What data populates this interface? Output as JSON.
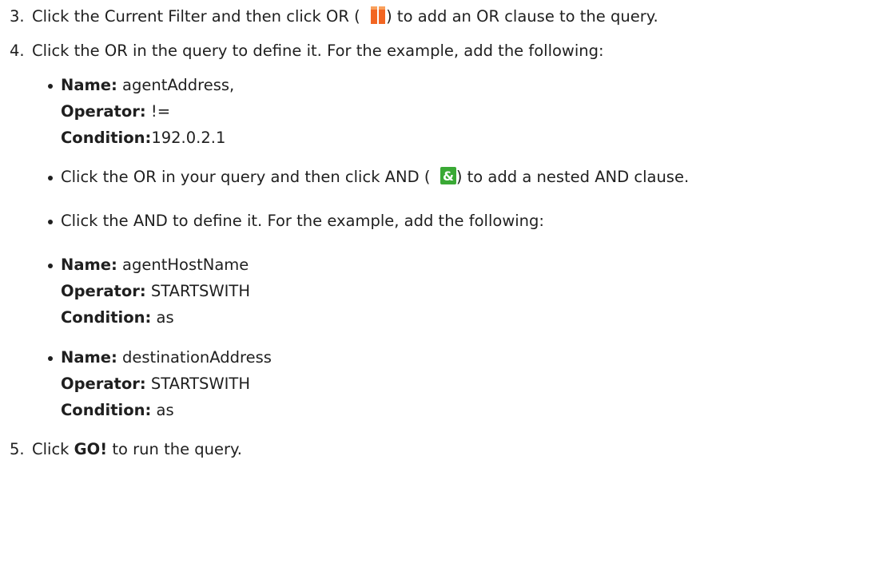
{
  "steps": {
    "s3": {
      "num": "3.",
      "pre": "Click the Current Filter and then click OR (",
      "icon": "or-icon",
      "post": ") to add an OR clause to the query."
    },
    "s4": {
      "num": "4.",
      "text": "Click the OR in the query to define it. For the example, add the following:"
    },
    "b1": {
      "name_label": "Name:",
      "name_value": " agentAddress,",
      "operator_label": "Operator:",
      "operator_value": " !=",
      "condition_label": "Condition:",
      "condition_value": "192.0.2.1"
    },
    "b2": {
      "pre": "Click the OR in your query and then click AND (",
      "icon": "and-icon",
      "post": ") to add a nested AND clause."
    },
    "b3": {
      "text": "Click the AND to define it. For the example, add the following:"
    },
    "b4": {
      "name_label": "Name:",
      "name_value": " agentHostName",
      "operator_label": "Operator:",
      "operator_value": " STARTSWITH",
      "condition_label": "Condition:",
      "condition_value": " as"
    },
    "b5": {
      "name_label": "Name:",
      "name_value": " destinationAddress",
      "operator_label": "Operator:",
      "operator_value": " STARTSWITH",
      "condition_label": "Condition:",
      "condition_value": " as"
    },
    "s5": {
      "num": "5.",
      "pre": "Click ",
      "go": "GO!",
      "post": " to run the query."
    }
  },
  "colors": {
    "or_icon": "#f26522",
    "and_icon": "#3aa935"
  }
}
